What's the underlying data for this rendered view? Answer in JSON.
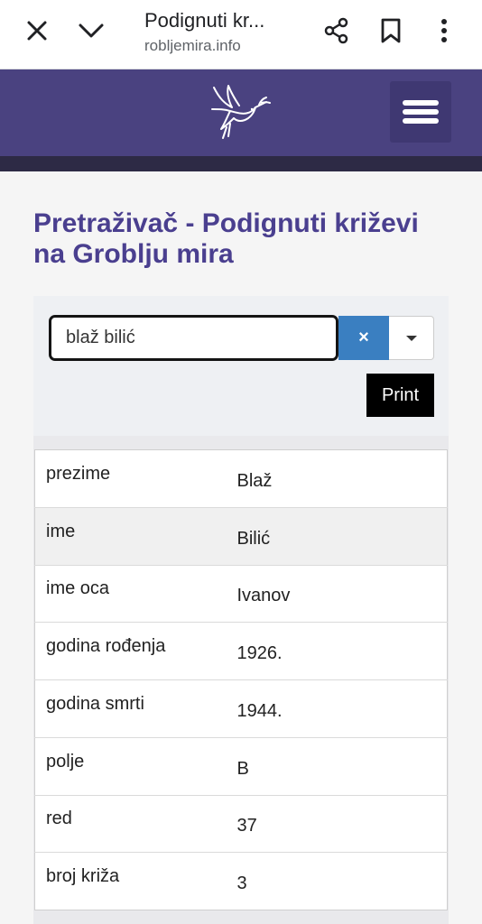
{
  "browser": {
    "tab_title": "Podignuti kr...",
    "url": "robljemira.info"
  },
  "page": {
    "title": "Pretraživač - Podignuti križevi na Groblju mira"
  },
  "search": {
    "value": "blaž bilić",
    "clear_label": "×",
    "print_label": "Print"
  },
  "record": [
    {
      "label": "prezime",
      "value": "Blaž"
    },
    {
      "label": "ime",
      "value": "Bilić"
    },
    {
      "label": "ime oca",
      "value": "Ivanov"
    },
    {
      "label": "godina rođenja",
      "value": "1926."
    },
    {
      "label": "godina smrti",
      "value": "1944."
    },
    {
      "label": "polje",
      "value": "B"
    },
    {
      "label": "red",
      "value": "37"
    },
    {
      "label": "broj križa",
      "value": "3"
    }
  ],
  "colors": {
    "header": "#4a4280",
    "title": "#4a3f8f",
    "clear_button": "#3a7fc1"
  },
  "icons": [
    "close-icon",
    "chevron-down-icon",
    "share-icon",
    "bookmark-icon",
    "more-vert-icon",
    "dove-logo",
    "hamburger-menu-icon",
    "caret-down-icon"
  ]
}
